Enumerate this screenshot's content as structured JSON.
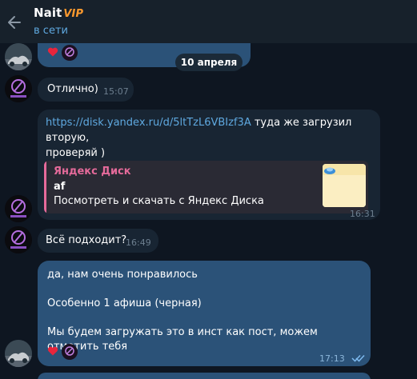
{
  "header": {
    "title": "Nait",
    "badge": "VIP",
    "status": "в сети"
  },
  "date_separator": "10 апреля",
  "messages": [
    {
      "kind": "incoming",
      "text": "Отлично)",
      "time": "15:07"
    },
    {
      "kind": "incoming",
      "link": "https://disk.yandex.ru/d/5ltTzL6VBIzf3A",
      "text_after_link": " туда же загрузил вторую,",
      "text_line2": "проверяй )",
      "preview": {
        "site": "Яндекс Диск",
        "title": "af",
        "description": "Посмотреть и скачать с Яндекс Диска"
      },
      "time": "16:31"
    },
    {
      "kind": "incoming",
      "text": "Всё подходит?",
      "time": "16:49"
    },
    {
      "kind": "outgoing",
      "lines": [
        "да, нам очень понравилось",
        "Особенно 1 афиша (черная)",
        "Мы будем загружать это в инст как пост, можем отметить тебя"
      ],
      "time": "17:13"
    }
  ],
  "reactions": {
    "emoji": "heart"
  },
  "colors": {
    "background": "#0e1621",
    "header": "#17212b",
    "incoming_bubble": "#182533",
    "outgoing_bubble": "#2b5278",
    "link": "#5fa9e0",
    "preview_accent": "#e56a9a",
    "vip_badge": "#ff9a2e"
  }
}
